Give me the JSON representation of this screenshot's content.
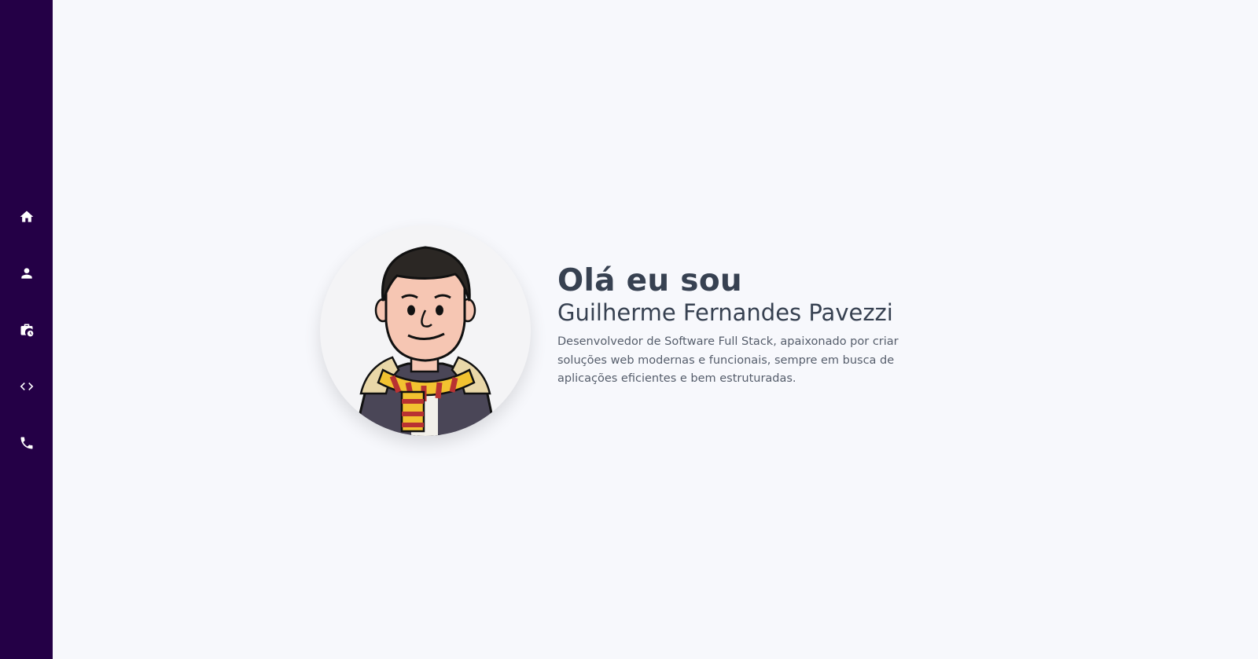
{
  "sidebar": {
    "items": [
      {
        "icon": "home-icon",
        "name": "nav-home"
      },
      {
        "icon": "user-icon",
        "name": "nav-about"
      },
      {
        "icon": "briefcase-icon",
        "name": "nav-experience"
      },
      {
        "icon": "code-icon",
        "name": "nav-projects"
      },
      {
        "icon": "phone-icon",
        "name": "nav-contact"
      }
    ],
    "background": "#240046",
    "icon_color": "#ffffff"
  },
  "hero": {
    "greeting": "Olá eu sou",
    "name": "Guilherme Fernandes Pavezzi",
    "bio": "Desenvolvedor de Software Full Stack, apaixonado por criar soluções web modernas e funcionais, sempre em busca de aplicações eficientes e bem estruturadas.",
    "avatar": "cartoon-avatar"
  },
  "colors": {
    "page_background": "#f7f8fc",
    "text_primary": "#374151",
    "text_secondary": "#555d6b"
  }
}
